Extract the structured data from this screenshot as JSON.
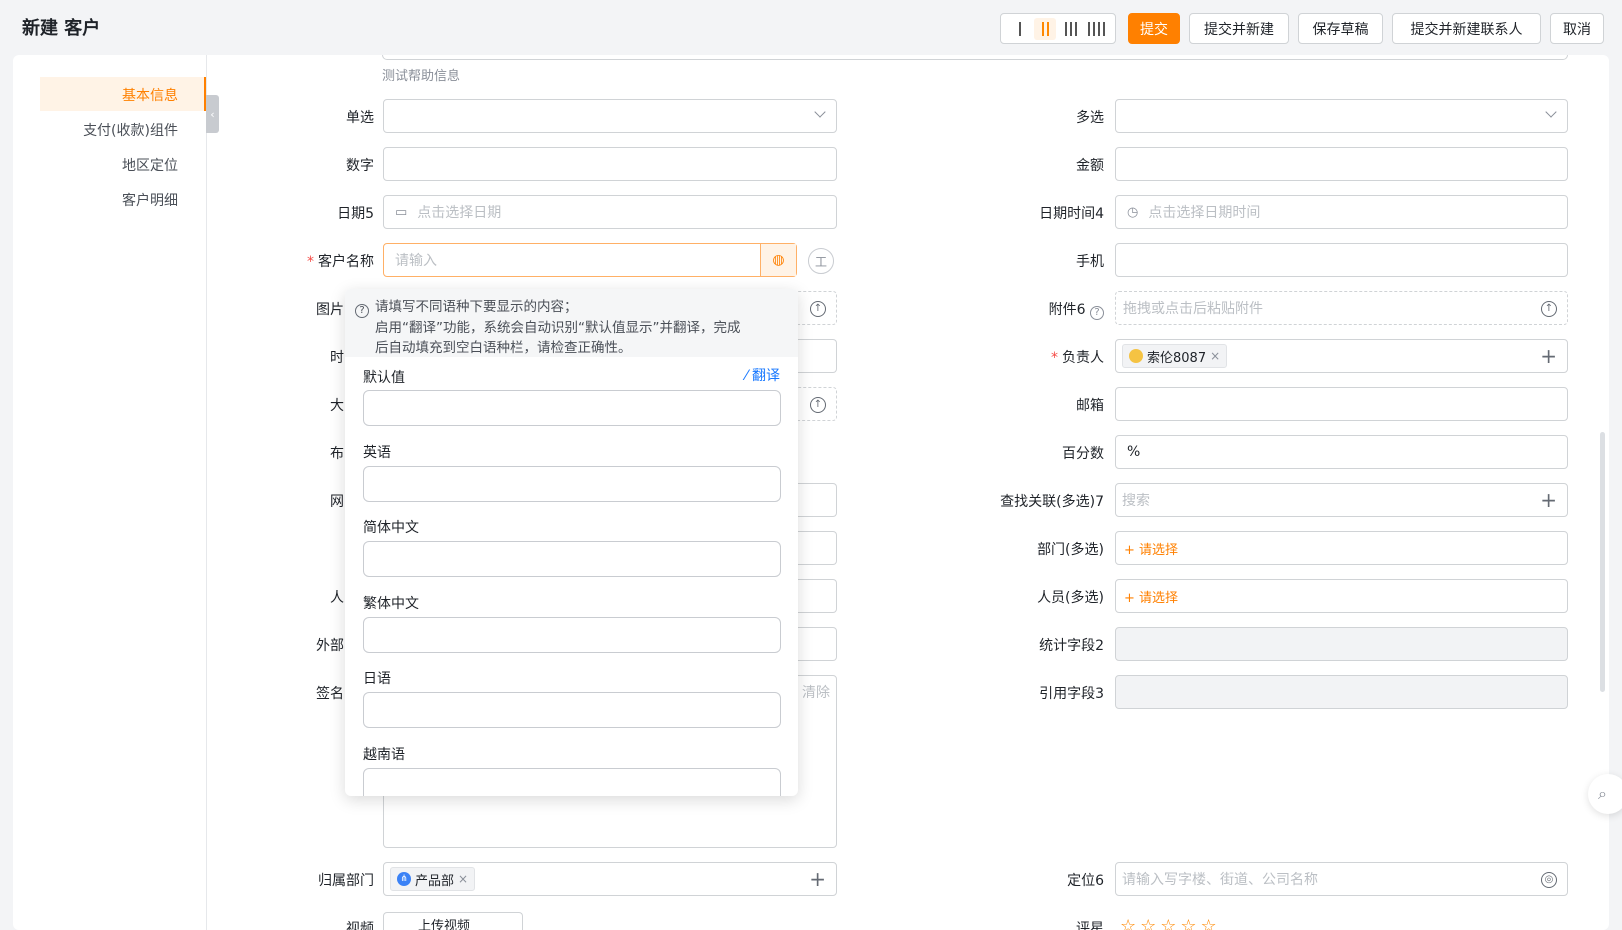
{
  "header": {
    "title": "新建 客户",
    "buttons": {
      "submit": "提交",
      "submit_new": "提交并新建",
      "save_draft": "保存草稿",
      "submit_new_contact": "提交并新建联系人",
      "cancel": "取消"
    },
    "accent_color": "#ff8000"
  },
  "sidebar": {
    "items": [
      {
        "label": "基本信息",
        "active": true
      },
      {
        "label": "支付(收款)组件",
        "active": false
      },
      {
        "label": "地区定位",
        "active": false
      },
      {
        "label": "客户明细",
        "active": false
      }
    ]
  },
  "form": {
    "help_text": "测试帮助信息",
    "left": {
      "single_select": {
        "label": "单选"
      },
      "number": {
        "label": "数字"
      },
      "date": {
        "label": "日期5",
        "placeholder": "点击选择日期"
      },
      "customer_name": {
        "label": "客户名称",
        "placeholder": "请输入",
        "required": true
      },
      "image": {
        "label": "图片"
      },
      "time_partial": {
        "label": "时"
      },
      "big_partial": {
        "label": "大"
      },
      "bool_partial": {
        "label": "布"
      },
      "web_partial": {
        "label": "网"
      },
      "person_partial": {
        "label": "人"
      },
      "external_partial": {
        "label": "外部"
      },
      "signature": {
        "label": "签名",
        "clear": "清除"
      },
      "department": {
        "label": "归属部门",
        "tag": "产品部"
      },
      "video_partial": {
        "label": "视频",
        "upload": "上传视频"
      }
    },
    "right": {
      "multi_select": {
        "label": "多选"
      },
      "amount": {
        "label": "金额"
      },
      "datetime": {
        "label": "日期时间4",
        "placeholder": "点击选择日期时间"
      },
      "mobile": {
        "label": "手机"
      },
      "attachment": {
        "label": "附件6",
        "placeholder": "拖拽或点击后粘贴附件"
      },
      "owner": {
        "label": "负责人",
        "tag": "索伦8087",
        "required": true
      },
      "email": {
        "label": "邮箱"
      },
      "percent": {
        "label": "百分数",
        "value": "%"
      },
      "lookup": {
        "label": "查找关联(多选)7",
        "placeholder": "搜索"
      },
      "dept_multi": {
        "label": "部门(多选)",
        "action": "+ 请选择"
      },
      "person_multi": {
        "label": "人员(多选)",
        "action": "+ 请选择"
      },
      "stat_field": {
        "label": "统计字段2"
      },
      "ref_field": {
        "label": "引用字段3"
      },
      "location": {
        "label": "定位6",
        "placeholder": "请输入写字楼、街道、公司名称"
      },
      "rating_partial": {
        "label": "评星",
        "stars": 5
      }
    }
  },
  "popover": {
    "tip_line1": "请填写不同语种下要显示的内容；",
    "tip_line2": "启用“翻译”功能，系统会自动识别“默认值显示”并翻译，完成",
    "tip_line3": "后自动填充到空白语种栏，请检查正确性。",
    "translate": "翻译",
    "languages": [
      "默认值",
      "英语",
      "简体中文",
      "繁体中文",
      "日语",
      "越南语"
    ]
  }
}
